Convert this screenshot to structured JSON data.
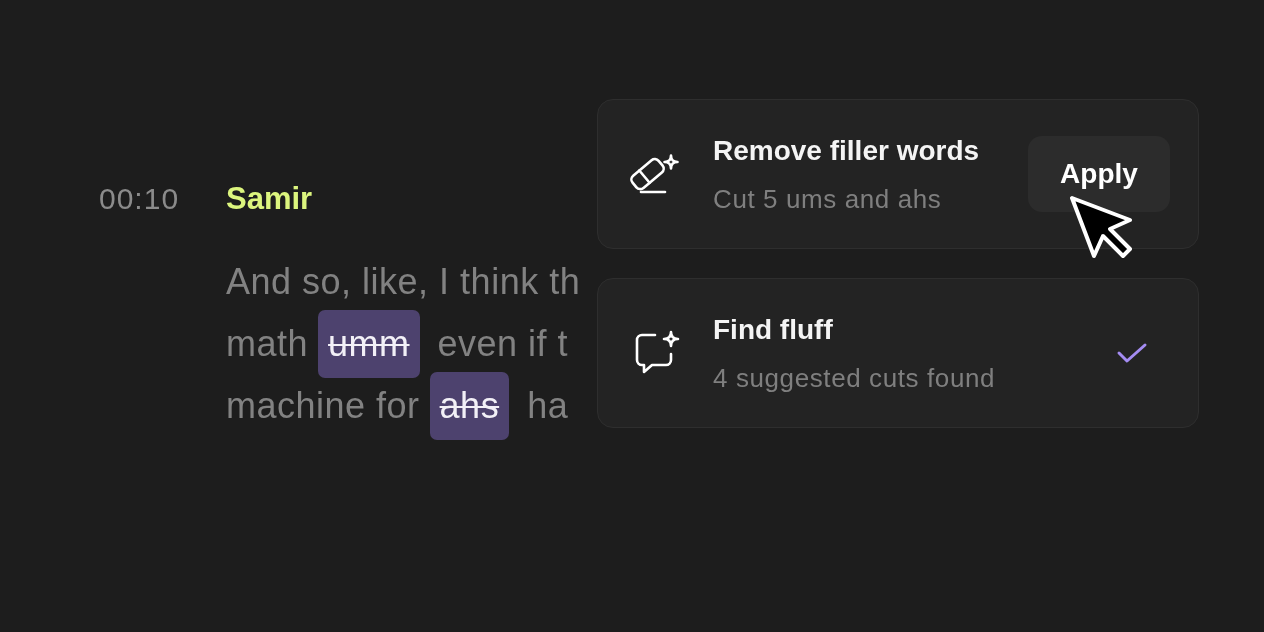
{
  "transcript": {
    "timestamp": "00:10",
    "speaker": "Samir",
    "lines": [
      {
        "segments": [
          {
            "text": "And so, like, I think th",
            "struck": false
          }
        ]
      },
      {
        "segments": [
          {
            "text": "math",
            "struck": false
          },
          {
            "text": "umm",
            "struck": true
          },
          {
            "text": "even if t",
            "struck": false
          }
        ]
      },
      {
        "segments": [
          {
            "text": "machine for",
            "struck": false
          },
          {
            "text": "ahs",
            "struck": true
          },
          {
            "text": "ha",
            "struck": false
          }
        ]
      }
    ]
  },
  "actions": [
    {
      "kind": "remove",
      "title": "Remove filler words",
      "subtitle": "Cut 5 ums and ahs",
      "button": {
        "label": "Apply",
        "hovered": true
      },
      "done": false
    },
    {
      "kind": "find",
      "title": "Find fluff",
      "subtitle": "4 suggested cuts found",
      "done": true
    }
  ]
}
